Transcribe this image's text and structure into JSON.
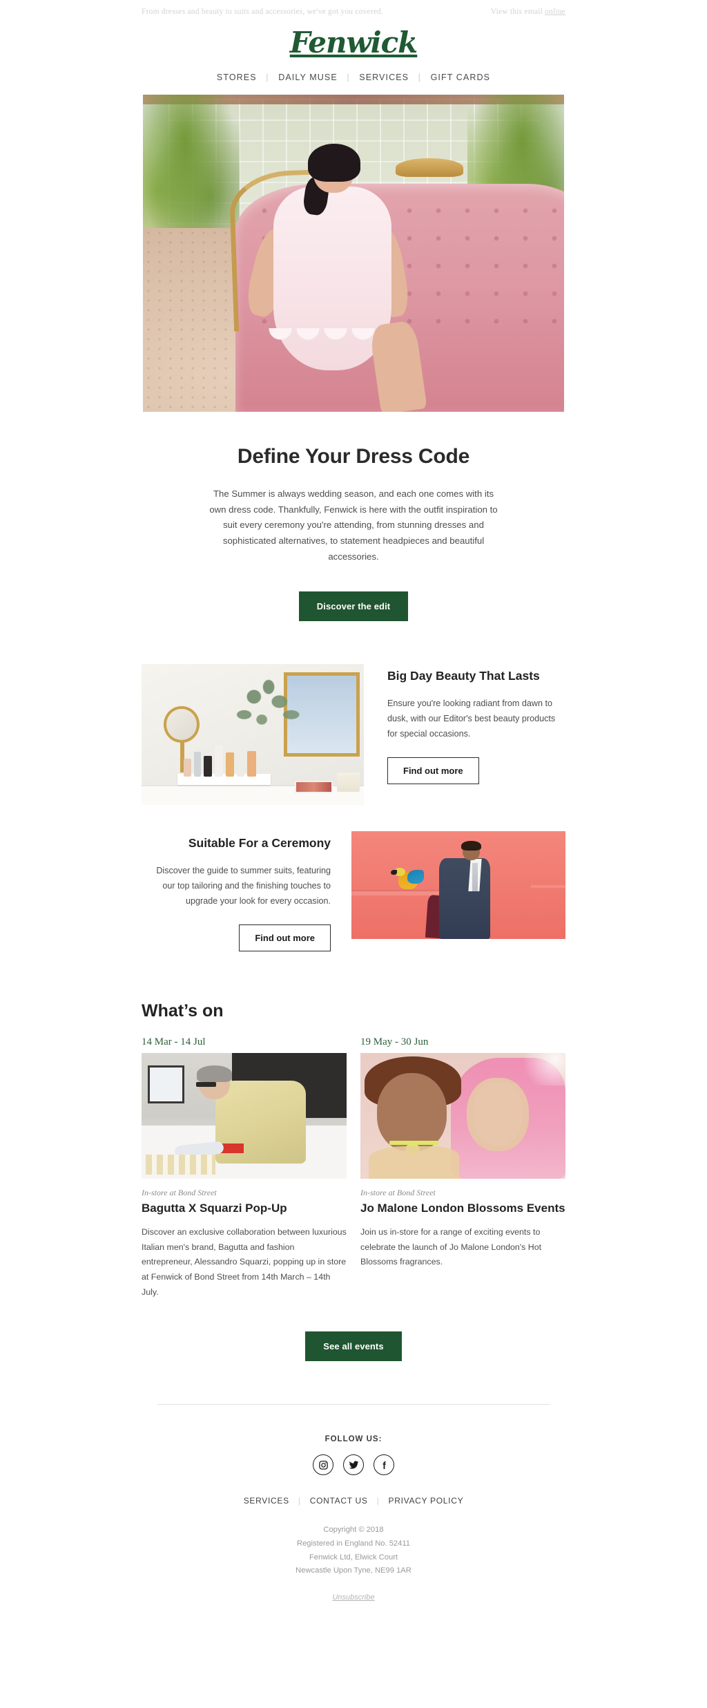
{
  "preheader": {
    "tagline": "From dresses and beauty to suits and accessories, we've got you covered.",
    "view_prefix": "View this email ",
    "view_link": "online"
  },
  "brand": {
    "logo": "Fenwick",
    "green": "#1f5530"
  },
  "nav": {
    "items": [
      {
        "label": "STORES"
      },
      {
        "label": "DAILY MUSE"
      },
      {
        "label": "SERVICES"
      },
      {
        "label": "GIFT CARDS"
      }
    ],
    "separator": "|"
  },
  "hero": {
    "alt": "Model in pale pink scalloped dress seated on a pink tufted sofa"
  },
  "intro": {
    "heading": "Define Your Dress Code",
    "body": "The Summer is always wedding season, and each one comes with its own dress code. Thankfully, Fenwick is here with the outfit inspiration to suit every ceremony you're attending, from stunning dresses and sophisticated alternatives, to statement headpieces and beautiful accessories.",
    "cta": "Discover the edit"
  },
  "features": [
    {
      "heading": "Big Day Beauty That Lasts",
      "body": "Ensure you're looking radiant from dawn to dusk, with our Editor's best beauty products for special occasions.",
      "cta": "Find out more",
      "alt": "Vanity table with gold mirror, eucalyptus and beauty products"
    },
    {
      "heading": "Suitable For a Ceremony",
      "body": "Discover the guide to summer suits, featuring our top tailoring and the finishing touches to upgrade your look for every occasion.",
      "cta": "Find out more",
      "alt": "Man in a navy suit in front of a coral pink wall with a macaw"
    }
  ],
  "whats_on": {
    "heading": "What’s on",
    "cta": "See all events",
    "events": [
      {
        "date": "14 Mar - 14 Jul",
        "venue": "In-store at Bond Street",
        "title": "Bagutta X Squarzi Pop-Up",
        "body": "Discover an exclusive collaboration between luxurious Italian men's brand, Bagutta and fashion entrepreneur, Alessandro Squarzi, popping up in store at Fenwick of Bond Street from 14th March – 14th July.",
        "alt": "Designer in a cream jacket working over a studio table"
      },
      {
        "date": "19 May - 30 Jun",
        "venue": "In-store at Bond Street",
        "title": "Jo Malone London Blossoms Events",
        "body": "Join us in-store for a range of exciting events to celebrate the launch of Jo Malone London's Hot Blossoms fragrances.",
        "alt": "Two models, one with curly hair and one with pink hair"
      }
    ]
  },
  "footer": {
    "follow_label": "FOLLOW US:",
    "social": [
      {
        "name": "instagram",
        "label": "Instagram"
      },
      {
        "name": "twitter",
        "label": "Twitter"
      },
      {
        "name": "facebook",
        "label": "Facebook"
      }
    ],
    "links": [
      {
        "label": "SERVICES"
      },
      {
        "label": "CONTACT US"
      },
      {
        "label": "PRIVACY POLICY"
      }
    ],
    "separator": "|",
    "legal": [
      "Copyright © 2018",
      "Registered in England No. 52411",
      "Fenwick Ltd, Elwick Court",
      "Newcastle Upon Tyne, NE99 1AR"
    ],
    "unsubscribe": "Unsubscribe"
  }
}
